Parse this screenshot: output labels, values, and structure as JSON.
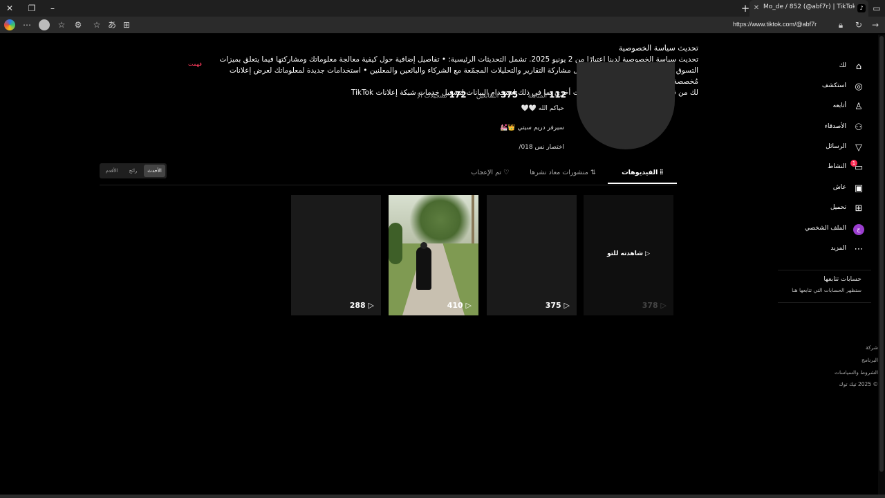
{
  "browser": {
    "tab_title": "Mo_de / 852 (@abf7r) | TikTok",
    "tab_favicon": "tiktok-icon",
    "url": "https://www.tiktok.com/@abf7r"
  },
  "banner": {
    "title": "تحديث سياسة الخصوصية",
    "line1": "تحديث سياسة الخصوصية لدينا اعتبارًا من 2 يونيو 2025. تشمل التحديثات الرئيسية: • تفاصيل إضافية حول كيفية معالجة معلوماتك ومشاركتها فيما يتعلق بميزات",
    "line2": "التسوق لدينا • المزيد من المعلومات حول مشاركة التقارير والتحليلات المجمّعة مع الشركاء والبائعين والمعلنين • استخدامات جديدة لمعلوماتك لعرض إعلانات مُخصصة",
    "line3": "لك من قبل المُعلنين على مواقع وتطبيقات أخرى بما في ذلك استخدام البيانات لتشغيل خدمات شبكة إعلانات TikTok",
    "dismiss": "فهمت"
  },
  "profile": {
    "following_count": "112",
    "following_label": "المتابَعة",
    "followers_count": "375",
    "followers_label": "المتابعين",
    "likes_count": "172",
    "likes_label": "تسجيلات الإعجاب",
    "bio1": "حياكم الله 🤍🤍",
    "bio2": "سيرفر دريم سيتي 👑💒",
    "bio3": "اختصار نس 018/"
  },
  "tabs": {
    "videos": "الفيديوهات",
    "reposts": "منشورات معاد نشرها",
    "liked": "تم الإعجاب"
  },
  "sort": {
    "latest": "الأحدث",
    "popular": "رائج",
    "oldest": "الأقدم"
  },
  "videos": [
    {
      "views": "378",
      "overlay": "شاهدته للتو"
    },
    {
      "views": "375"
    },
    {
      "views": "410"
    },
    {
      "views": "288"
    }
  ],
  "sidebar": {
    "items": [
      {
        "label": "لك",
        "icon": "home-icon"
      },
      {
        "label": "استكشف",
        "icon": "compass-icon"
      },
      {
        "label": "أتابعه",
        "icon": "user-follow-icon"
      },
      {
        "label": "الأصدقاء",
        "icon": "friends-icon"
      },
      {
        "label": "الرسائل",
        "icon": "send-icon"
      },
      {
        "label": "النشاط",
        "icon": "activity-icon",
        "badge": "1"
      },
      {
        "label": "عاش",
        "icon": "live-icon"
      },
      {
        "label": "تحميل",
        "icon": "upload-icon"
      },
      {
        "label": "الملف الشخصي",
        "icon": "profile-icon",
        "initial": "ج"
      },
      {
        "label": "المزيد",
        "icon": "more-icon"
      }
    ],
    "following_title": "حسابات تتابعها",
    "following_sub": "ستظهر الحسابات التي تتابعها هنا",
    "footer": [
      "شركة",
      "البرنامج",
      "الشروط والسياسات",
      "© 2025 تيك توك"
    ]
  }
}
